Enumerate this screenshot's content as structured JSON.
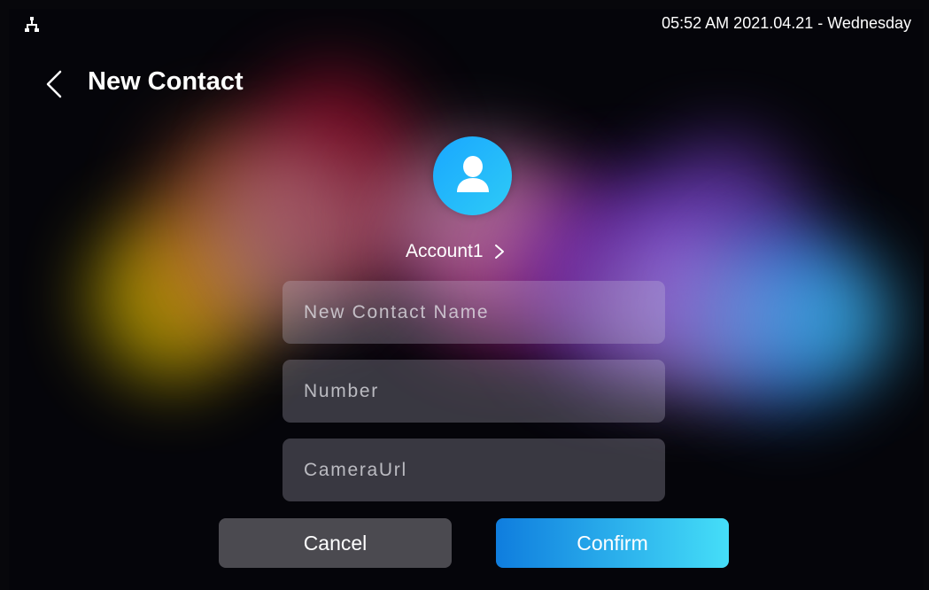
{
  "status_bar": {
    "datetime": "05:52 AM  2021.04.21 - Wednesday",
    "network_icon": "network-topology-icon"
  },
  "header": {
    "back_icon": "chevron-left-icon",
    "title": "New Contact"
  },
  "avatar": {
    "icon": "person-icon",
    "color_start": "#19a7ff",
    "color_end": "#2ecbf6"
  },
  "account": {
    "label": "Account1",
    "icon": "chevron-right-icon"
  },
  "form": {
    "name_placeholder": "New Contact Name",
    "name_value": "",
    "number_placeholder": "Number",
    "number_value": "",
    "camera_placeholder": "CameraUrl",
    "camera_value": ""
  },
  "buttons": {
    "cancel_label": "Cancel",
    "confirm_label": "Confirm",
    "confirm_gradient_start": "#0f7dde",
    "confirm_gradient_end": "#45def8",
    "cancel_color": "#4b4a50"
  }
}
